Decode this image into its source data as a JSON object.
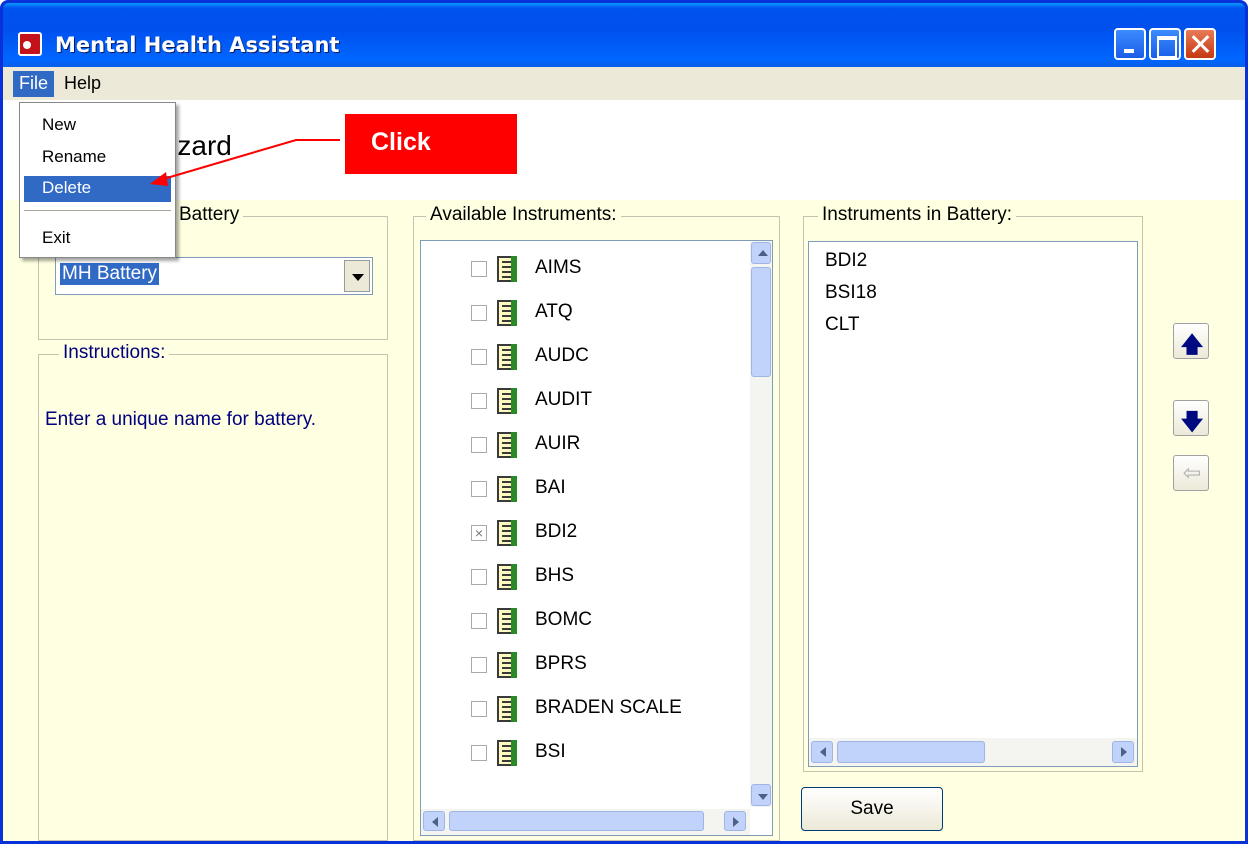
{
  "window": {
    "title": "Mental Health Assistant"
  },
  "menubar": {
    "file_label": "File",
    "help_label": "Help"
  },
  "file_menu": {
    "items": [
      "New",
      "Rename",
      "Delete",
      "Exit"
    ],
    "selected": "Delete"
  },
  "header": {
    "title_visible": "Vizard"
  },
  "battery_group": {
    "label_visible": "Battery",
    "combo_value": "MH Battery"
  },
  "instructions": {
    "label": "Instructions:",
    "text": "Enter a unique name for battery."
  },
  "available": {
    "label": "Available Instruments:",
    "items": [
      {
        "name": "AIMS",
        "checked": false
      },
      {
        "name": "ATQ",
        "checked": false
      },
      {
        "name": "AUDC",
        "checked": false
      },
      {
        "name": "AUDIT",
        "checked": false
      },
      {
        "name": "AUIR",
        "checked": false
      },
      {
        "name": "BAI",
        "checked": false
      },
      {
        "name": "BDI2",
        "checked": true
      },
      {
        "name": "BHS",
        "checked": false
      },
      {
        "name": "BOMC",
        "checked": false
      },
      {
        "name": "BPRS",
        "checked": false
      },
      {
        "name": "BRADEN SCALE",
        "checked": false
      },
      {
        "name": "BSI",
        "checked": false
      }
    ]
  },
  "battery_instruments": {
    "label": "Instruments in Battery:",
    "items": [
      "BDI2",
      "BSI18",
      "CLT"
    ]
  },
  "buttons": {
    "save_label": "Save",
    "move_up_glyph": "🡅",
    "move_down_glyph": "🡇",
    "remove_glyph": "⇦"
  },
  "callout": {
    "text": "Click",
    "color": "#ff0000"
  },
  "colors": {
    "title_bar": "#0054e3",
    "client_bg": "#ffffe1",
    "selection": "#316ac5",
    "group_label": "#000080"
  }
}
